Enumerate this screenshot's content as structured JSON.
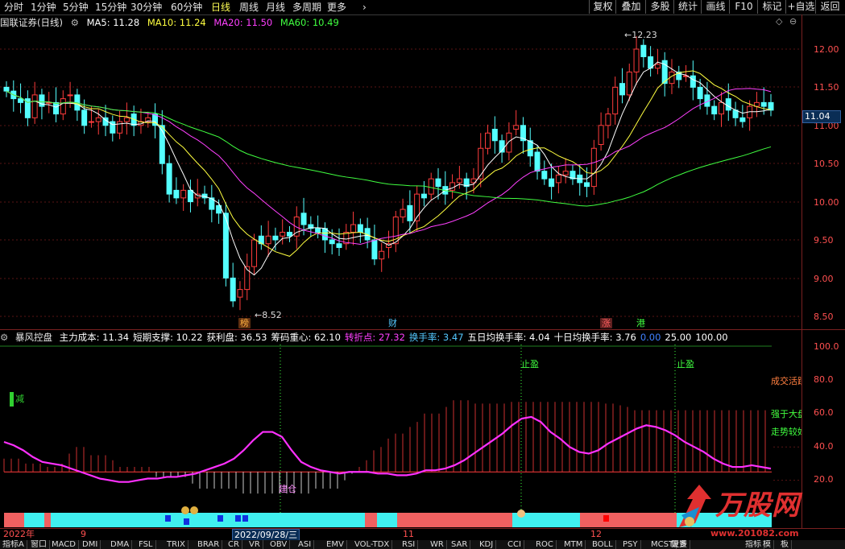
{
  "toolbar": {
    "periods": [
      "分时",
      "1分钟",
      "5分钟",
      "15分钟",
      "30分钟",
      "60分钟",
      "日线",
      "周线",
      "月线",
      "多周期",
      "更多"
    ],
    "active_period": "日线",
    "right_buttons": [
      "复权",
      "叠加",
      "多股",
      "统计",
      "画线",
      "F10",
      "标记",
      "+自选",
      "返回"
    ]
  },
  "chart_header": {
    "title": "国联证券(日线)",
    "ma5": "MA5: 11.28",
    "ma10": "MA10: 11.24",
    "ma20": "MA20: 11.50",
    "ma60": "MA60: 10.49"
  },
  "colors": {
    "up": "#ff3c3c",
    "down": "#54ffff",
    "ma5": "#ffffff",
    "ma10": "#ffff40",
    "ma20": "#ff40ff",
    "ma60": "#40ff40"
  },
  "price_axis": {
    "labels": [
      "12.00",
      "11.50",
      "11.00",
      "10.50",
      "10.00",
      "9.50",
      "9.00",
      "8.50"
    ],
    "current": "11.04"
  },
  "price_annotations": {
    "high": "12.23",
    "low": "8.52"
  },
  "event_tags": [
    "榜",
    "财",
    "涨",
    "港"
  ],
  "indicator_header": {
    "name": "暴风控盘",
    "items": [
      {
        "label": "主力成本: 11.34",
        "color": "#ffffff"
      },
      {
        "label": "短期支撑: 10.22",
        "color": "#ffffff"
      },
      {
        "label": "获利盘: 36.53",
        "color": "#ffffff"
      },
      {
        "label": "筹码重心: 62.10",
        "color": "#ffffff"
      },
      {
        "label": "转折点: 27.32",
        "color": "#ff40ff"
      },
      {
        "label": "换手率: 3.47",
        "color": "#54c8ff"
      },
      {
        "label": "五日均换手率: 4.04",
        "color": "#ffffff"
      },
      {
        "label": "十日均换手率: 3.76",
        "color": "#ffffff"
      },
      {
        "label": "0.00",
        "color": "#4080ff"
      },
      {
        "label": "25.00",
        "color": "#ffffff"
      },
      {
        "label": "100.00",
        "color": "#ffffff"
      }
    ]
  },
  "indicator_axis": [
    "100.0",
    "80.0",
    "60.0",
    "40.0",
    "20.0"
  ],
  "indicator_annotations": {
    "jian": "减",
    "jiancang": "建仓",
    "zhiying1": "止盈",
    "zhiying2": "止盈",
    "side1": "成交活跃",
    "side2": "强于大盘",
    "side3": "走势较好"
  },
  "date_axis": {
    "labels": [
      "2022年",
      "9",
      "2022/09/28/三",
      "11",
      "12"
    ]
  },
  "bottom_tabs": [
    "指标A",
    "窗口",
    "MACD",
    "DMI",
    "DMA",
    "FSL",
    "TRIX",
    "BRAR",
    "CR",
    "VR",
    "OBV",
    "ASI",
    "EMV",
    "VOL-TDX",
    "RSI",
    "WR",
    "SAR",
    "KDJ",
    "CCI",
    "ROC",
    "MTM",
    "BOLL",
    "PSY",
    "MCST",
    "更多",
    "设置"
  ],
  "bottom_right_tabs": [
    "指标",
    "模",
    "板"
  ],
  "logo": {
    "text": "万股网",
    "url": "www.201082.com"
  }
}
